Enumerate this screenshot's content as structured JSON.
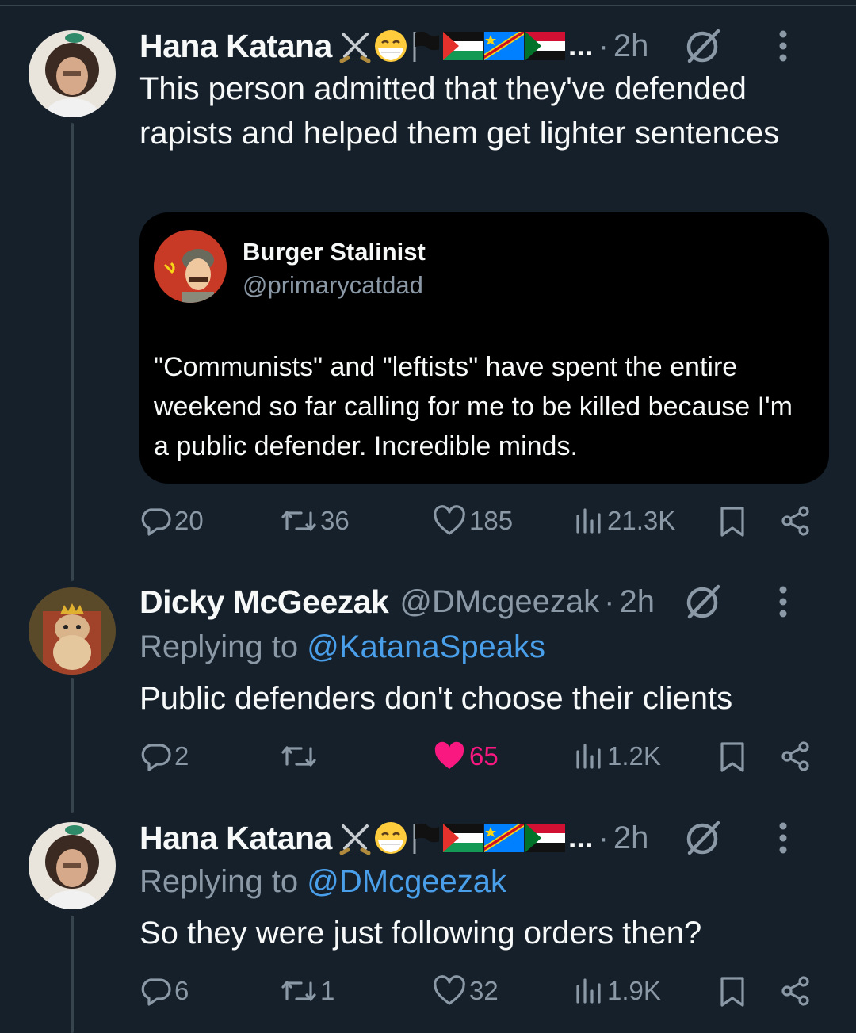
{
  "tweets": [
    {
      "name": "Hana Katana",
      "emoji_ellipsis": "...",
      "time": "2h",
      "body": "This person admitted that they've defended rapists and helped them get lighter sentences",
      "quote": {
        "name": "Burger Stalinist",
        "handle": "@primarycatdad",
        "text": "\"Communists\" and \"leftists\" have spent the entire weekend so far calling for me to be killed because I'm a public defender. Incredible minds."
      },
      "stats": {
        "replies": "20",
        "reposts": "36",
        "likes": "185",
        "views": "21.3K"
      }
    },
    {
      "name": "Dicky McGeezak",
      "handle": "@DMcgeezak",
      "time": "2h",
      "replying_label": "Replying to",
      "replying_to": "@KatanaSpeaks",
      "body": "Public defenders don't choose their clients",
      "stats": {
        "replies": "2",
        "reposts": "",
        "likes": "65",
        "views": "1.2K"
      }
    },
    {
      "name": "Hana Katana",
      "emoji_ellipsis": "...",
      "time": "2h",
      "replying_label": "Replying to",
      "replying_to": "@DMcgeezak",
      "body": "So they were just following orders then?",
      "stats": {
        "replies": "6",
        "reposts": "1",
        "likes": "32",
        "views": "1.9K"
      }
    }
  ],
  "separator": "·",
  "colors": {
    "background": "#15202b",
    "muted": "#8b98a5",
    "accent": "#4a9fea",
    "like": "#f91880"
  },
  "icons": [
    "reply-icon",
    "repost-icon",
    "like-icon",
    "views-icon",
    "bookmark-icon",
    "share-icon",
    "grok-icon",
    "more-icon",
    "crossed-swords-emoji",
    "mask-face-emoji",
    "black-flag-emoji",
    "palestine-flag-emoji",
    "congo-flag-emoji",
    "sudan-flag-emoji"
  ]
}
